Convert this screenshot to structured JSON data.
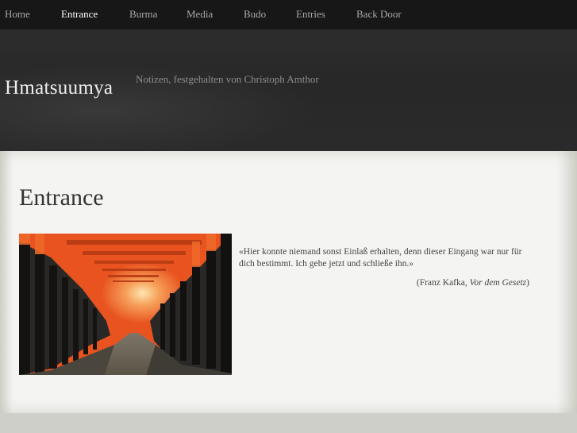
{
  "nav": {
    "items": [
      {
        "label": "Home"
      },
      {
        "label": "Entrance",
        "active": true
      },
      {
        "label": "Burma"
      },
      {
        "label": "Media"
      },
      {
        "label": "Budo"
      },
      {
        "label": "Entries"
      },
      {
        "label": "Back Door"
      }
    ]
  },
  "header": {
    "site_title": "Hmatsuumya",
    "tagline": "Notizen, festgehalten von Christoph Amthor"
  },
  "main": {
    "page_title": "Entrance",
    "quote": "«Hier konnte niemand sonst Einlaß erhalten, denn dieser Eingang war nur für dich bestimmt. Ich gehe jetzt und schließe ihn.»",
    "attribution_author": "(Franz Kafka, ",
    "attribution_work": "Vor dem Gesetz",
    "attribution_close": ")"
  },
  "colors": {
    "nav_bg": "#171717",
    "header_bg": "#2a2a2a",
    "content_bg": "#f4f5f2",
    "torii_orange": "#e8531f"
  }
}
